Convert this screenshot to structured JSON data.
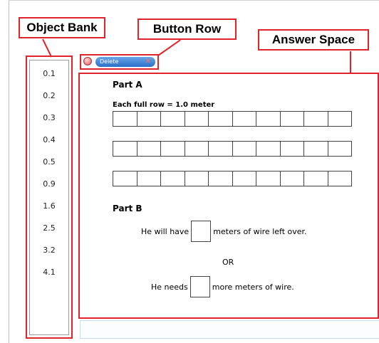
{
  "callouts": {
    "object_bank": "Object Bank",
    "button_row": "Button Row",
    "answer_space": "Answer Space"
  },
  "object_bank": {
    "items": [
      "0.1",
      "0.2",
      "0.3",
      "0.4",
      "0.5",
      "0.9",
      "1.6",
      "2.5",
      "3.2",
      "4.1"
    ]
  },
  "toolbar": {
    "radio_icon": "radio-button-icon",
    "delete_label": "Delete",
    "delete_close_icon": "close-icon",
    "close_glyph": "✕"
  },
  "answer": {
    "part_a_title": "Part A",
    "part_a_subtitle": "Each full row = 1.0 meter",
    "grid_rows": 3,
    "grid_columns": 10,
    "part_b_title": "Part B",
    "sentence1_before": "He will have",
    "sentence1_after": "meters of wire left over.",
    "or_label": "OR",
    "sentence2_before": "He needs",
    "sentence2_after": "more meters of wire."
  },
  "colors": {
    "callout_border": "#e0242c",
    "delete_button": "#2c6fc8"
  }
}
